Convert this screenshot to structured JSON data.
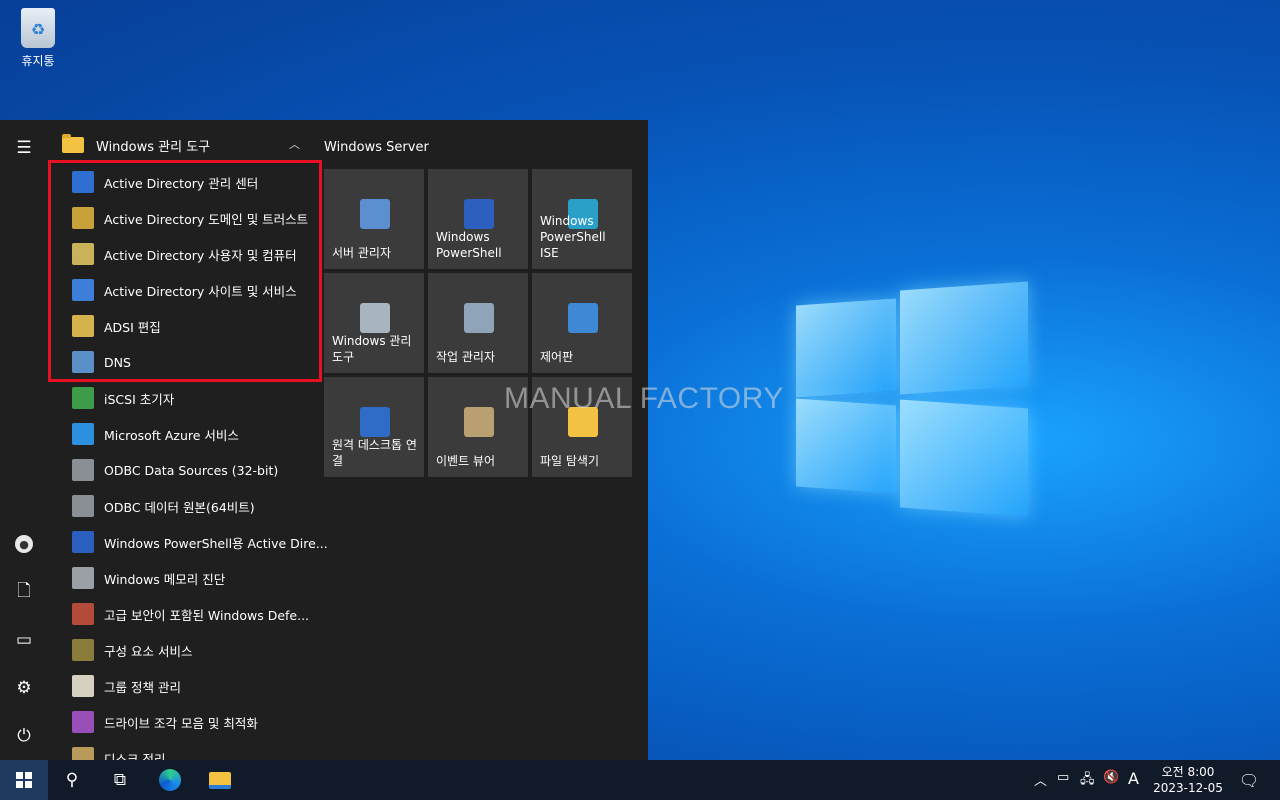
{
  "desktop": {
    "recycle_bin_label": "휴지통",
    "watermark": "MANUAL FACTORY"
  },
  "start_menu": {
    "group_header": "Windows 관리 도구",
    "apps": [
      {
        "label": "Active Directory 관리 센터",
        "icon": "ad-admin-center-icon",
        "color": "#2f6fd1"
      },
      {
        "label": "Active Directory 도메인 및 트러스트",
        "icon": "ad-domains-trusts-icon",
        "color": "#c9a13a"
      },
      {
        "label": "Active Directory 사용자 및 컴퓨터",
        "icon": "ad-users-computers-icon",
        "color": "#c9b25a"
      },
      {
        "label": "Active Directory 사이트 및 서비스",
        "icon": "ad-sites-services-icon",
        "color": "#3d7fd8"
      },
      {
        "label": "ADSI 편집",
        "icon": "adsi-edit-icon",
        "color": "#d4b24c"
      },
      {
        "label": "DNS",
        "icon": "dns-icon",
        "color": "#5a8fc8"
      },
      {
        "label": "iSCSI 초기자",
        "icon": "iscsi-initiator-icon",
        "color": "#3c9c4a"
      },
      {
        "label": "Microsoft Azure 서비스",
        "icon": "azure-services-icon",
        "color": "#2d8fe0"
      },
      {
        "label": "ODBC Data Sources (32-bit)",
        "icon": "odbc-32-icon",
        "color": "#8a8f96"
      },
      {
        "label": "ODBC 데이터 원본(64비트)",
        "icon": "odbc-64-icon",
        "color": "#8a8f96"
      },
      {
        "label": "Windows PowerShell용 Active Dire...",
        "icon": "powershell-ad-icon",
        "color": "#2a5fbf"
      },
      {
        "label": "Windows 메모리 진단",
        "icon": "memory-diagnostic-icon",
        "color": "#9aa0a6"
      },
      {
        "label": "고급 보안이 포함된 Windows Defe...",
        "icon": "defender-firewall-icon",
        "color": "#b34a3a"
      },
      {
        "label": "구성 요소 서비스",
        "icon": "component-services-icon",
        "color": "#8a7d3c"
      },
      {
        "label": "그룹 정책 관리",
        "icon": "group-policy-icon",
        "color": "#d6d0c0"
      },
      {
        "label": "드라이브 조각 모음 및 최적화",
        "icon": "defrag-icon",
        "color": "#9a4fb8"
      },
      {
        "label": "디스크 정리",
        "icon": "disk-cleanup-icon",
        "color": "#b89a5a"
      }
    ],
    "tiles_title": "Windows Server",
    "tiles": [
      {
        "label": "서버 관리자",
        "icon": "server-manager-icon",
        "color": "#5b8fd0"
      },
      {
        "label": "Windows PowerShell",
        "icon": "powershell-icon",
        "color": "#2d5fbf"
      },
      {
        "label": "Windows PowerShell ISE",
        "icon": "powershell-ise-icon",
        "color": "#2aa0c8"
      },
      {
        "label": "Windows 관리 도구",
        "icon": "admin-tools-icon",
        "color": "#a8b4c0"
      },
      {
        "label": "작업 관리자",
        "icon": "task-manager-icon",
        "color": "#8fa4b8"
      },
      {
        "label": "제어판",
        "icon": "control-panel-icon",
        "color": "#3f88d6"
      },
      {
        "label": "원격 데스크톱 연결",
        "icon": "remote-desktop-icon",
        "color": "#2f6cc8"
      },
      {
        "label": "이벤트 뷰어",
        "icon": "event-viewer-icon",
        "color": "#b8a070"
      },
      {
        "label": "파일 탐색기",
        "icon": "file-explorer-icon",
        "color": "#f3c242"
      }
    ]
  },
  "taskbar": {
    "clock_time": "오전 8:00",
    "clock_date": "2023-12-05",
    "ime_label": "A"
  }
}
